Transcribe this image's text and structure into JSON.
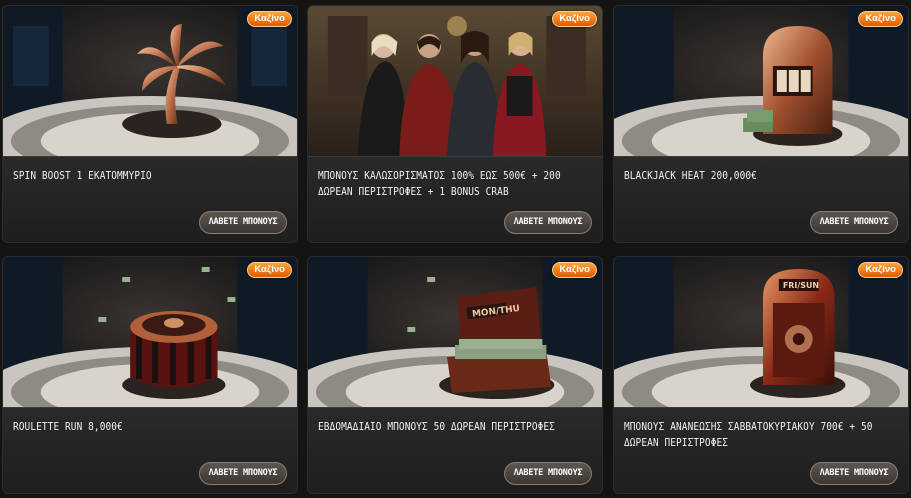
{
  "promotions": [
    {
      "title": "SPIN BOOST 1 ΕΚΑΤΟΜΜΥΡΙΟ",
      "badge": "Καζίνο",
      "button": "ΛΑΒΕΤΕ ΜΠΟΝΟΥΣ",
      "art": "palm-tree-statue"
    },
    {
      "title": "ΜΠΟΝΟΥΣ ΚΑΛΩΣΟΡΙΣΜΑΤΟΣ 100% ΕΩΣ 500€ + 200 ΔΩΡΕΑΝ ΠΕΡΙΣΤΡΟΦΕΣ + 1 BONUS CRAB",
      "badge": "Καζίνο",
      "button": "ΛΑΒΕΤΕ ΜΠΟΝΟΥΣ",
      "art": "four-characters"
    },
    {
      "title": "BLACKJACK HEAT 200,000€",
      "badge": "Καζίνο",
      "button": "ΛΑΒΕΤΕ ΜΠΟΝΟΥΣ",
      "art": "slot-machine"
    },
    {
      "title": "ROULETTE RUN 8,000€",
      "badge": "Καζίνο",
      "button": "ΛΑΒΕΤΕ ΜΠΟΝΟΥΣ",
      "art": "roulette-wheel"
    },
    {
      "title": "ΕΒΔΟΜΑΔΙΑΙΟ ΜΠΟΝΟΥΣ 50 ΔΩΡΕΑΝ ΠΕΡΙΣΤΡΟΦΕΣ",
      "badge": "Καζίνο",
      "button": "ΛΑΒΕΤΕ ΜΠΟΝΟΥΣ",
      "art": "money-chest"
    },
    {
      "title": "ΜΠΟΝΟΥΣ ΑΝΑΝΕΩΣΗΣ ΣΑΒΒΑΤΟΚΥΡΙΑΚΟΥ 700€ + 50 ΔΩΡΕΑΝ ΠΕΡΙΣΤΡΟΦΕΣ",
      "badge": "Καζίνο",
      "button": "ΛΑΒΕΤΕ ΜΠΟΝΟΥΣ",
      "art": "safe-vault"
    }
  ],
  "chest_label": "MON/THU",
  "vault_label": "FRI/SUN",
  "colors": {
    "badge": "#f07a10",
    "button": "#4a4540",
    "card": "#232323",
    "background": "#141414"
  }
}
